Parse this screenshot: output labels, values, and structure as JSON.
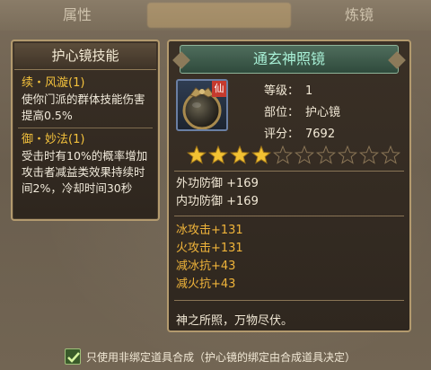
{
  "tabs": {
    "attr": "属性",
    "synth": "",
    "refine": "炼镜"
  },
  "skills_panel": {
    "title": "护心镜技能",
    "skills": [
      {
        "title": "续・风漩(1)",
        "desc": "使你门派的群体技能伤害提高0.5%"
      },
      {
        "title": "御・妙法(1)",
        "desc": "受击时有10%的概率增加攻击者减益类效果持续时间2%，冷却时间30秒"
      }
    ]
  },
  "item": {
    "name": "通玄神照镜",
    "badge": "仙",
    "level_label": "等级：",
    "level": "1",
    "slot_label": "部位：",
    "slot": "护心镜",
    "score_label": "评分：",
    "score": "7692",
    "stars_filled": 4,
    "stars_total": 10,
    "base_stats": [
      "外功防御 +169",
      "内功防御 +169"
    ],
    "bonus_stats": [
      "冰攻击+131",
      "火攻击+131",
      "减冰抗+43",
      "减火抗+43"
    ],
    "flavor": "神之所照，万物尽伏。"
  },
  "footer": {
    "checkbox_label": "只使用非绑定道具合成（护心镜的绑定由合成道具决定）",
    "checked": true
  },
  "colors": {
    "gold_text": "#f0b43a",
    "skill_title": "#f4c23c",
    "banner_text": "#a8f0d6",
    "panel_border": "#b39a6e"
  }
}
